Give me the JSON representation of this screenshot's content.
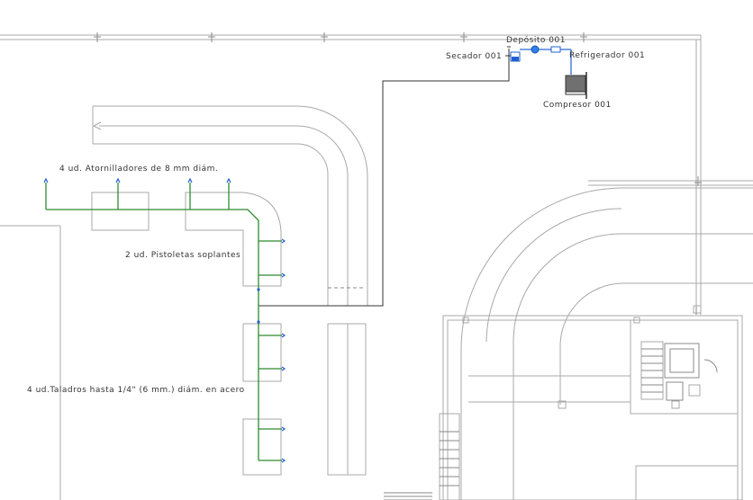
{
  "labels": {
    "deposito": "Depósito 001",
    "secador": "Secador 001",
    "refrigerador": "Refrigerador 001",
    "compresor": "Compresor 001",
    "atornilladores": "4 ud. Atornilladores de 8 mm diám.",
    "pistoletas": "2 ud. Pistoletas soplantes",
    "taladros": "4 ud.Taladros hasta 1/4\" (6 mm.) diám. en acero"
  },
  "colors": {
    "wall": "#a8a8a8",
    "main_pipe": "#333333",
    "branch_pipe": "#2e8b2e",
    "outlet": "#2060d0",
    "compressor_body": "#707070"
  }
}
